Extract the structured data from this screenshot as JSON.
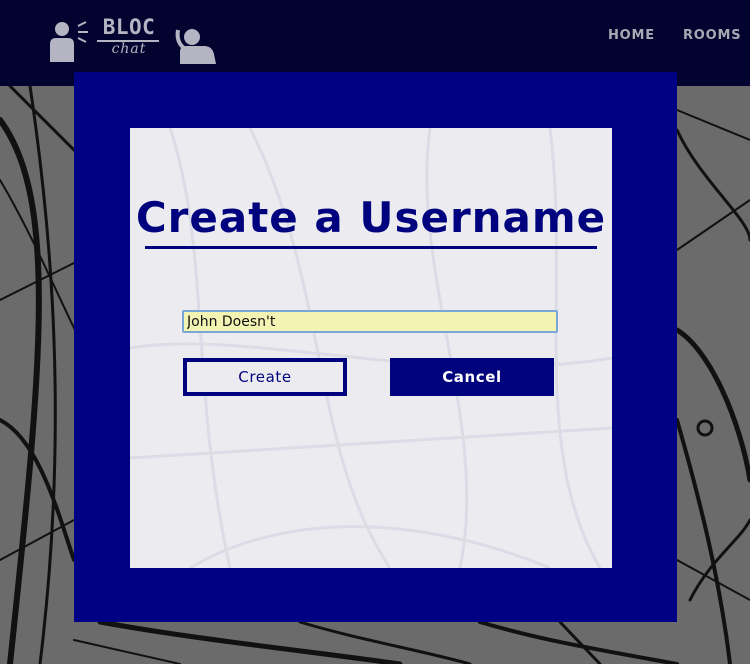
{
  "app": {
    "logo_title": "BLOC",
    "logo_subtitle": "chat"
  },
  "nav": {
    "items": [
      {
        "label": "HOME"
      },
      {
        "label": "ROOMS"
      }
    ]
  },
  "modal": {
    "title": "Create a Username",
    "username_value": "John Doesn't",
    "create_label": "Create",
    "cancel_label": "Cancel"
  },
  "colors": {
    "nav_background": "#02032e",
    "modal_frame": "#000183",
    "modal_body": "#ebebf0",
    "accent": "#01037e",
    "input_background": "#f3f4b4"
  },
  "icons": [
    "speaking-person-icon",
    "listening-person-icon"
  ]
}
